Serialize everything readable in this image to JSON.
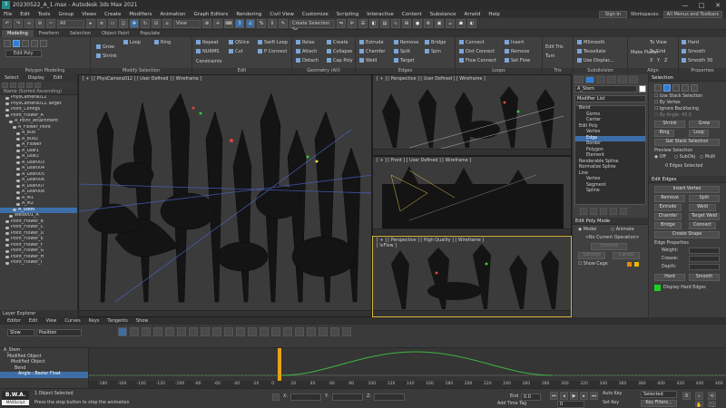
{
  "title_bar": {
    "title": "20230522_A_1.max - Autodesk 3ds Max 2021",
    "app_icon": "3ds-max-icon",
    "controls": [
      "—",
      "□",
      "✕"
    ]
  },
  "menu": {
    "items": [
      "File",
      "Edit",
      "Tools",
      "Group",
      "Views",
      "Create",
      "Modifiers",
      "Animation",
      "Graph Editors",
      "Rendering",
      "Civil View",
      "Customize",
      "Scripting",
      "Interactive",
      "Content",
      "Substance",
      "Arnold",
      "Help"
    ],
    "sign_in": "Sign In",
    "workspaces_label": "Workspaces:",
    "workspace_value": "All Menus and Toolbars"
  },
  "toolbar": {
    "filter": "All",
    "view": "View",
    "selection_set": "Create Selection Se"
  },
  "ribbon_tabs": [
    "Modeling",
    "Freeform",
    "Selection",
    "Object Paint",
    "Populate"
  ],
  "ribbon": {
    "polygon_modeling": {
      "title": "Polygon Modeling",
      "edit_poly": "Edit Poly"
    },
    "modify_selection": {
      "title": "Modify Selection",
      "items": [
        "Grow",
        "Shrink",
        "Loop",
        "Ring"
      ]
    },
    "edit": {
      "title": "Edit",
      "items": [
        "Repeat",
        "QSlice",
        "Swift Loop",
        "NURMS",
        "Cut",
        "P Connect",
        "Constraints"
      ]
    },
    "geometry": {
      "title": "Geometry (All)",
      "items": [
        "Relax",
        "Create",
        "Attach",
        "Collapse",
        "Detach",
        "Cap Poly"
      ]
    },
    "edges": {
      "title": "Edges",
      "items": [
        "Extrude",
        "Remove",
        "Bridge",
        "Chamfer",
        "Split",
        "Spin",
        "Weld",
        "Target"
      ]
    },
    "loops": {
      "title": "Loops",
      "items": [
        "Connect",
        "Insert",
        "Dist Connect",
        "Remove",
        "Flow Connect",
        "Set Flow"
      ]
    },
    "tris": {
      "title": "Tris",
      "items": [
        "Edit Tris",
        "Turn"
      ]
    },
    "subdivision": {
      "title": "Subdivision",
      "items": [
        "MSmooth",
        "Tessellate",
        "Use Displac..."
      ]
    },
    "align": {
      "title": "Align",
      "items": [
        "Make Planar",
        "To View",
        "To Grid",
        "X",
        "Y",
        "Z"
      ]
    },
    "properties": {
      "title": "Properties",
      "items": [
        "Hard",
        "Smooth",
        "Smooth 30"
      ]
    }
  },
  "scene_explorer": {
    "tabs": [
      "Select",
      "Display",
      "Edit"
    ],
    "header": "Name (Sorted Ascending)",
    "items": [
      {
        "name": "PhysCamera012",
        "indent": 1,
        "sel": false
      },
      {
        "name": "PhysCamera012.Target",
        "indent": 1,
        "sel": false
      },
      {
        "name": "Point_Configs",
        "indent": 1,
        "sel": false
      },
      {
        "name": "Point_Flower_A",
        "indent": 1,
        "sel": false
      },
      {
        "name": "A_Point_Attachment",
        "indent": 2,
        "sel": false
      },
      {
        "name": "A_Flower_Point",
        "indent": 3,
        "sel": false
      },
      {
        "name": "A_Bud",
        "indent": 4,
        "sel": false
      },
      {
        "name": "A_Bud2",
        "indent": 4,
        "sel": false
      },
      {
        "name": "A_Flower",
        "indent": 4,
        "sel": false
      },
      {
        "name": "A_Leaf1",
        "indent": 4,
        "sel": false
      },
      {
        "name": "A_Leaf2",
        "indent": 4,
        "sel": false
      },
      {
        "name": "A_Leaf003",
        "indent": 4,
        "sel": false
      },
      {
        "name": "A_Leaf004",
        "indent": 4,
        "sel": false
      },
      {
        "name": "A_Leaf005",
        "indent": 4,
        "sel": false
      },
      {
        "name": "A_Leaf006",
        "indent": 4,
        "sel": false
      },
      {
        "name": "A_Leaf007",
        "indent": 4,
        "sel": false
      },
      {
        "name": "A_Leaf008",
        "indent": 4,
        "sel": false
      },
      {
        "name": "A_M1",
        "indent": 4,
        "sel": false
      },
      {
        "name": "A_M2",
        "indent": 4,
        "sel": false
      },
      {
        "name": "A_Stem",
        "indent": 3,
        "sel": true
      },
      {
        "name": "Weld001_A",
        "indent": 2,
        "sel": false
      },
      {
        "name": "Point_Flower_B",
        "indent": 1,
        "sel": false
      },
      {
        "name": "Point_Flower_C",
        "indent": 1,
        "sel": false
      },
      {
        "name": "Point_Flower_D",
        "indent": 1,
        "sel": false
      },
      {
        "name": "Point_Flower_E",
        "indent": 1,
        "sel": false
      },
      {
        "name": "Point_Flower_F",
        "indent": 1,
        "sel": false
      },
      {
        "name": "Point_Flower_G",
        "indent": 1,
        "sel": false
      },
      {
        "name": "Point_Flower_H",
        "indent": 1,
        "sel": false
      },
      {
        "name": "Point_Flower_I",
        "indent": 1,
        "sel": false
      }
    ],
    "footer": "Layer Explorer"
  },
  "viewports": {
    "main": "[ + ] [ PhysCamera012 ] [ User Defined ] [ Wireframe ]",
    "top_right": "[ + ] [ Perspective ] [ User Defined ] [ Wireframe ]",
    "mid_right": "[ + ] [ Front ] [ User Defined ] [ Wireframe ]",
    "bottom_right": "[ + ] [ Perspective ] [ High Quality ] [ Wireframe ]",
    "bottom_right_sub": "[ lvFlow ]"
  },
  "command_panel": {
    "object_name": "A_Stem",
    "modifier_list": "Modifier List",
    "stack": [
      {
        "name": "Bend",
        "sel": false
      },
      {
        "name": "Gizmo",
        "sel": false
      },
      {
        "name": "Center",
        "sel": false
      },
      {
        "name": "Edit Poly",
        "sel": false
      },
      {
        "name": "Vertex",
        "sel": false
      },
      {
        "name": "Edge",
        "sel": true
      },
      {
        "name": "Border",
        "sel": false
      },
      {
        "name": "Polygon",
        "sel": false
      },
      {
        "name": "Element",
        "sel": false
      },
      {
        "name": "Renderable Spline",
        "sel": false
      },
      {
        "name": "Normalize Spline",
        "sel": false
      },
      {
        "name": "Line",
        "sel": false
      },
      {
        "name": "Vertex",
        "sel": false
      },
      {
        "name": "Segment",
        "sel": false
      },
      {
        "name": "Spline",
        "sel": false
      }
    ],
    "edit_poly_mode": {
      "title": "Edit Poly Mode",
      "model": "Model",
      "animate": "Animate",
      "current_op": "<No Current Operation>",
      "commit": "Commit",
      "settings": "Settings",
      "cancel": "Cancel",
      "show_cage": "Show Cage"
    }
  },
  "selection_rollout": {
    "title": "Selection",
    "use_stack": "Use Stack Selection",
    "by_vertex": "By Vertex",
    "ignore_backfacing": "Ignore Backfacing",
    "by_angle": "By Angle:",
    "angle_value": "45.0",
    "shrink": "Shrink",
    "grow": "Grow",
    "ring": "Ring",
    "loop": "Loop",
    "get_stack": "Get Stack Selection",
    "preview": "Preview Selection",
    "off": "Off",
    "subobj": "SubObj",
    "multi": "Multi",
    "status": "0 Edges Selected"
  },
  "edit_edges_rollout": {
    "title": "Edit Edges",
    "insert_vertex": "Insert Vertex",
    "remove": "Remove",
    "split": "Split",
    "extrude": "Extrude",
    "weld": "Weld",
    "chamfer": "Chamfer",
    "target_weld": "Target Weld",
    "bridge": "Bridge",
    "connect": "Connect",
    "create_shape": "Create Shape",
    "edge_properties": "Edge Properties",
    "weight": "Weight:",
    "crease": "Crease:",
    "depth": "Depth:",
    "hard": "Hard",
    "smooth": "Smooth",
    "display_hard_edges": "Display Hard Edges"
  },
  "curve_editor": {
    "menu": [
      "Editor",
      "Edit",
      "View",
      "Curves",
      "Keys",
      "Tangents",
      "Show"
    ],
    "tab": "Slow",
    "filter": "Position",
    "tree": [
      {
        "name": "A_Stem",
        "sel": false
      },
      {
        "name": "Modified Object",
        "sel": false
      },
      {
        "name": "Modified Object",
        "sel": false
      },
      {
        "name": "Bend",
        "sel": false
      },
      {
        "name": "Angle : Bezier Float",
        "sel": true
      }
    ],
    "ruler": [
      "-180",
      "-160",
      "-140",
      "-120",
      "-100",
      "-80",
      "-60",
      "-40",
      "-20",
      "0",
      "20",
      "40",
      "60",
      "80",
      "100",
      "120",
      "140",
      "160",
      "180",
      "200",
      "220",
      "240",
      "260",
      "280",
      "300",
      "320",
      "340",
      "360",
      "380",
      "400",
      "420",
      "440",
      "460"
    ]
  },
  "status_bar": {
    "logo": "B.W.A.",
    "logo_sub": "MAXScript",
    "selected": "1 Object Selected",
    "prompt": "Press the stop button to stop the animation",
    "x_label": "X:",
    "y_label": "Y:",
    "z_label": "Z:",
    "end_label": "End",
    "end_value": "0.0",
    "add_time_tag": "Add Time Tag",
    "auto_key": "Auto Key",
    "selected_mode": "Selected",
    "set_key": "Set Key",
    "key_filters": "Key Filters...",
    "frame": "0"
  }
}
